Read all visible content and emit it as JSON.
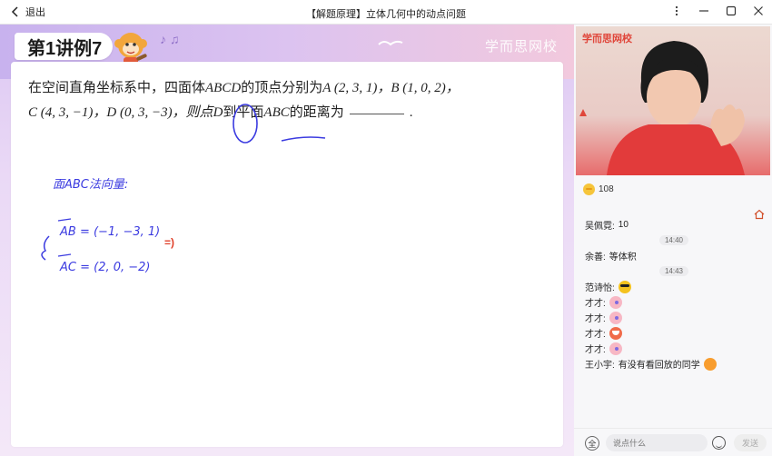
{
  "window": {
    "back_label": "退出",
    "title": "【解题原理】立体几何中的动点问题"
  },
  "lesson": {
    "tag": "第1讲例7",
    "watermark": "学而思网校",
    "problem": {
      "line1_a": "在空间直角坐标系中，四面体",
      "line1_b": "ABCD",
      "line1_c": "的顶点分别为",
      "line1_d": "A (2, 3, 1)，B (1, 0, 2)，",
      "line2_a": "C (4, 3, −1)，D (0, 3, −3)，则点",
      "line2_b": "D",
      "line2_c": "到平面",
      "line2_d": "ABC",
      "line2_e": "的距离为",
      "line2_f": "."
    },
    "handwriting": {
      "heading": "面ABC法向量:",
      "vector_ab": "AB = (−1, −3, 1)",
      "vector_ac": "AC = (2, 0, −2)",
      "arrow": "=)"
    }
  },
  "sidebar": {
    "video_brand": "学而思网校",
    "likes": "108",
    "chat": [
      {
        "type": "msg",
        "user": "吴佩霓:",
        "text": "10"
      },
      {
        "type": "time",
        "text": "14:40"
      },
      {
        "type": "msg",
        "user": "余善:",
        "text": "等体积"
      },
      {
        "type": "time",
        "text": "14:43"
      },
      {
        "type": "msg",
        "user": "范诗怡:",
        "text": "",
        "emoji": "sun"
      },
      {
        "type": "msg",
        "user": "才才:",
        "text": "",
        "emoji": "flower"
      },
      {
        "type": "msg",
        "user": "才才:",
        "text": "",
        "emoji": "flower"
      },
      {
        "type": "msg",
        "user": "才才:",
        "text": "",
        "emoji": "mouth"
      },
      {
        "type": "msg",
        "user": "才才:",
        "text": "",
        "emoji": "flower"
      },
      {
        "type": "msg",
        "user": "王小宇:",
        "text": "有没有看回放的同学",
        "emoji": "face"
      }
    ],
    "input_placeholder": "说点什么",
    "all_label": "全",
    "send_label": "发送"
  }
}
